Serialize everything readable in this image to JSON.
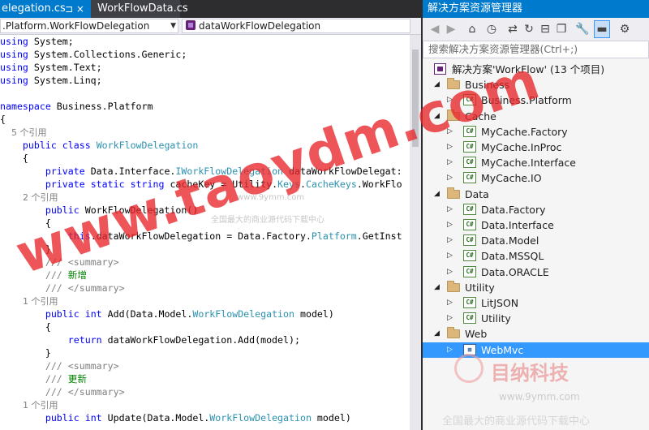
{
  "editor": {
    "tabs": [
      {
        "label": "elegation.cs",
        "icons": "⊐ ×"
      },
      {
        "label": "WorkFlowData.cs"
      }
    ],
    "nav_left": ".Platform.WorkFlowDelegation",
    "nav_right": "dataWorkFlowDelegation",
    "lines": [
      [
        {
          "t": "using",
          "c": "kw"
        },
        {
          "t": " System;"
        }
      ],
      [
        {
          "t": "using",
          "c": "kw"
        },
        {
          "t": " System.Collections.Generic;"
        }
      ],
      [
        {
          "t": "using",
          "c": "kw"
        },
        {
          "t": " System.Text;"
        }
      ],
      [
        {
          "t": "using",
          "c": "kw"
        },
        {
          "t": " System.Linq;"
        }
      ],
      [],
      [
        {
          "t": "namespace",
          "c": "kw"
        },
        {
          "t": " Business.Platform"
        }
      ],
      [
        {
          "t": "{"
        }
      ],
      [
        {
          "t": "    5 个引用",
          "c": "ref"
        }
      ],
      [
        {
          "t": "    "
        },
        {
          "t": "public",
          "c": "kw"
        },
        {
          "t": " "
        },
        {
          "t": "class",
          "c": "kw"
        },
        {
          "t": " "
        },
        {
          "t": "WorkFlowDelegation",
          "c": "ty"
        }
      ],
      [
        {
          "t": "    {"
        }
      ],
      [
        {
          "t": "        "
        },
        {
          "t": "private",
          "c": "kw"
        },
        {
          "t": " Data.Interface."
        },
        {
          "t": "IWorkFlowDelegation",
          "c": "ty"
        },
        {
          "t": " dataWorkFlowDelegat:"
        }
      ],
      [
        {
          "t": "        "
        },
        {
          "t": "private",
          "c": "kw"
        },
        {
          "t": " "
        },
        {
          "t": "static",
          "c": "kw"
        },
        {
          "t": " "
        },
        {
          "t": "string",
          "c": "kw"
        },
        {
          "t": " cacheKey = Utility."
        },
        {
          "t": "Keys",
          "c": "ty"
        },
        {
          "t": "."
        },
        {
          "t": "CacheKeys",
          "c": "ty"
        },
        {
          "t": ".WorkFlo"
        }
      ],
      [
        {
          "t": "        2 个引用",
          "c": "ref"
        }
      ],
      [
        {
          "t": "        "
        },
        {
          "t": "public",
          "c": "kw"
        },
        {
          "t": " WorkFlowDelegation()"
        }
      ],
      [
        {
          "t": "        {"
        }
      ],
      [
        {
          "t": "            "
        },
        {
          "t": "this",
          "c": "kw"
        },
        {
          "t": ".dataWorkFlowDelegation = Data.Factory."
        },
        {
          "t": "Platform",
          "c": "ty"
        },
        {
          "t": ".GetInst"
        }
      ],
      [
        {
          "t": "        }"
        }
      ],
      [
        {
          "t": "        "
        },
        {
          "t": "///",
          "c": "gr"
        },
        {
          "t": " "
        },
        {
          "t": "<summary>",
          "c": "gr"
        }
      ],
      [
        {
          "t": "        "
        },
        {
          "t": "///",
          "c": "gr"
        },
        {
          "t": " 新增",
          "c": "cm"
        }
      ],
      [
        {
          "t": "        "
        },
        {
          "t": "///",
          "c": "gr"
        },
        {
          "t": " "
        },
        {
          "t": "</summary>",
          "c": "gr"
        }
      ],
      [
        {
          "t": "        1 个引用",
          "c": "ref"
        }
      ],
      [
        {
          "t": "        "
        },
        {
          "t": "public",
          "c": "kw"
        },
        {
          "t": " "
        },
        {
          "t": "int",
          "c": "kw"
        },
        {
          "t": " Add(Data.Model."
        },
        {
          "t": "WorkFlowDelegation",
          "c": "ty"
        },
        {
          "t": " model)"
        }
      ],
      [
        {
          "t": "        {"
        }
      ],
      [
        {
          "t": "            "
        },
        {
          "t": "return",
          "c": "kw"
        },
        {
          "t": " dataWorkFlowDelegation.Add(model);"
        }
      ],
      [
        {
          "t": "        }"
        }
      ],
      [
        {
          "t": "        "
        },
        {
          "t": "///",
          "c": "gr"
        },
        {
          "t": " "
        },
        {
          "t": "<summary>",
          "c": "gr"
        }
      ],
      [
        {
          "t": "        "
        },
        {
          "t": "///",
          "c": "gr"
        },
        {
          "t": " 更新",
          "c": "cm"
        }
      ],
      [
        {
          "t": "        "
        },
        {
          "t": "///",
          "c": "gr"
        },
        {
          "t": " "
        },
        {
          "t": "</summary>",
          "c": "gr"
        }
      ],
      [
        {
          "t": "        1 个引用",
          "c": "ref"
        }
      ],
      [
        {
          "t": "        "
        },
        {
          "t": "public",
          "c": "kw"
        },
        {
          "t": " "
        },
        {
          "t": "int",
          "c": "kw"
        },
        {
          "t": " Update(Data.Model."
        },
        {
          "t": "WorkFlowDelegation",
          "c": "ty"
        },
        {
          "t": " model)"
        }
      ]
    ]
  },
  "solution_explorer": {
    "title": "解决方案资源管理器",
    "toolbar_icons": [
      "back-icon",
      "forward-icon",
      "home-icon",
      "history-icon",
      "sync-icon",
      "refresh-icon",
      "collapse-all-icon",
      "show-all-files-icon",
      "properties-icon",
      "preview-icon",
      "settings-icon"
    ],
    "search_placeholder": "搜索解决方案资源管理器(Ctrl+;)",
    "tree": [
      {
        "label": "解决方案'WorkFlow' (13 个项目)",
        "kind": "solution",
        "level": 0,
        "expander": ""
      },
      {
        "label": "Business",
        "kind": "folder",
        "level": 1,
        "expander": "◢"
      },
      {
        "label": "Business.Platform",
        "kind": "project",
        "level": 2,
        "expander": "▷"
      },
      {
        "label": "Cache",
        "kind": "folder",
        "level": 1,
        "expander": "◢"
      },
      {
        "label": "MyCache.Factory",
        "kind": "project",
        "level": 2,
        "expander": "▷"
      },
      {
        "label": "MyCache.InProc",
        "kind": "project",
        "level": 2,
        "expander": "▷"
      },
      {
        "label": "MyCache.Interface",
        "kind": "project",
        "level": 2,
        "expander": "▷"
      },
      {
        "label": "MyCache.IO",
        "kind": "project",
        "level": 2,
        "expander": "▷"
      },
      {
        "label": "Data",
        "kind": "folder",
        "level": 1,
        "expander": "◢"
      },
      {
        "label": "Data.Factory",
        "kind": "project",
        "level": 2,
        "expander": "▷"
      },
      {
        "label": "Data.Interface",
        "kind": "project",
        "level": 2,
        "expander": "▷"
      },
      {
        "label": "Data.Model",
        "kind": "project",
        "level": 2,
        "expander": "▷"
      },
      {
        "label": "Data.MSSQL",
        "kind": "project",
        "level": 2,
        "expander": "▷"
      },
      {
        "label": "Data.ORACLE",
        "kind": "project",
        "level": 2,
        "expander": "▷"
      },
      {
        "label": "Utility",
        "kind": "folder",
        "level": 1,
        "expander": "◢"
      },
      {
        "label": "LitJSON",
        "kind": "project",
        "level": 2,
        "expander": "▷"
      },
      {
        "label": "Utility",
        "kind": "project",
        "level": 2,
        "expander": "▷"
      },
      {
        "label": "Web",
        "kind": "folder",
        "level": 1,
        "expander": "◢"
      },
      {
        "label": "WebMvc",
        "kind": "webproject",
        "level": 2,
        "expander": "▷",
        "selected": true
      }
    ]
  },
  "watermark": {
    "main": "www.taoydm.com",
    "sub1": "全国最大的商业源代码下载中心",
    "sub2": "www.9ymm.com",
    "sub3": "全国最大的商业源代码下载中心",
    "brand": "目纳科技",
    "small_site": "www.9ymm.com",
    "small_text": "全国最大的商业源代码下载中心"
  },
  "colors": {
    "accent": "#007acc",
    "selection": "#3399ff",
    "keyword": "#0000ff",
    "type": "#2b91af",
    "comment": "#008000"
  }
}
